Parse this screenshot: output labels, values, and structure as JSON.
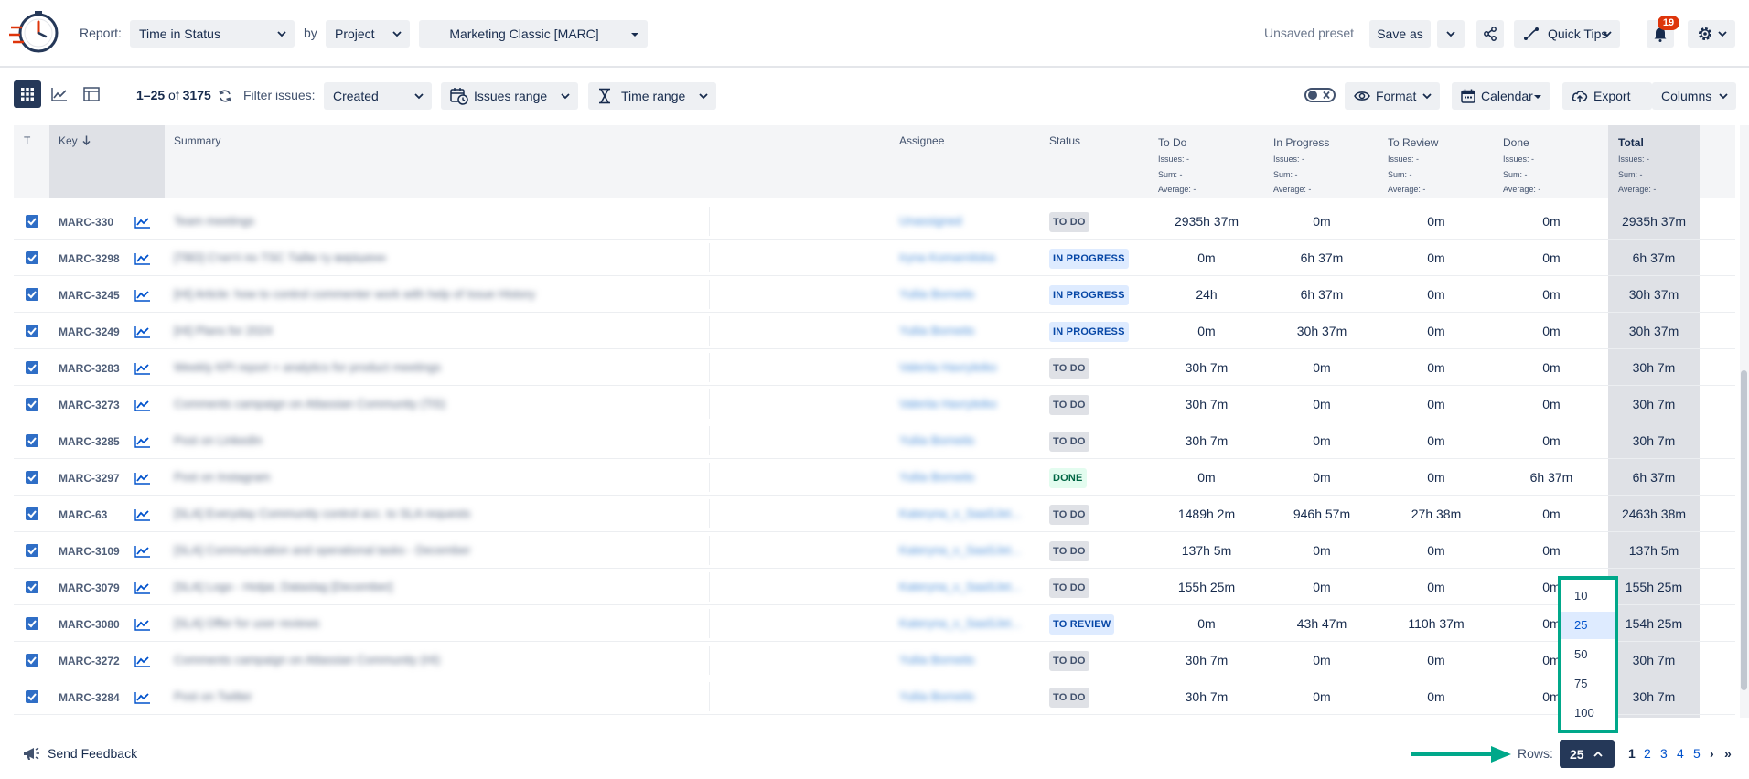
{
  "header": {
    "report_label": "Report:",
    "report_value": "Time in Status",
    "by_label": "by",
    "by_value": "Project",
    "project_value": "Marketing Classic [MARC]",
    "preset_status": "Unsaved preset",
    "save_as": "Save as",
    "quick_tips": "Quick Tips",
    "notifications_count": "19"
  },
  "toolbar": {
    "range_first": "1–25",
    "range_of": "of",
    "range_total": "3175",
    "filter_label": "Filter issues:",
    "filter_value": "Created",
    "issues_range": "Issues range",
    "time_range": "Time range",
    "format": "Format",
    "calendar": "Calendar",
    "export": "Export",
    "columns": "Columns"
  },
  "columns": {
    "t": "T",
    "key": "Key",
    "summary": "Summary",
    "assignee": "Assignee",
    "status": "Status",
    "todo": "To Do",
    "inprogress": "In Progress",
    "toreview": "To Review",
    "done": "Done",
    "total": "Total",
    "issues_sub": "Issues: -",
    "sum_sub": "Sum: -",
    "avg_sub": "Average: -"
  },
  "rows": [
    {
      "key": "MARC-330",
      "summary": "Team meetings",
      "assignee": "Unassigned",
      "status": "TO DO",
      "todo": "2935h 37m",
      "prog": "0m",
      "rev": "0m",
      "done": "0m",
      "total": "2935h 37m"
    },
    {
      "key": "MARC-3298",
      "summary": "[TBD] Статті по TSC Тайм ту вирішенн",
      "assignee": "Iryna Komarnitska",
      "status": "IN PROGRESS",
      "todo": "0m",
      "prog": "6h 37m",
      "rev": "0m",
      "done": "0m",
      "total": "6h 37m"
    },
    {
      "key": "MARC-3245",
      "summary": "[HI] Article: how to control commenter work with help of Issue History",
      "assignee": "Yuliia Borneits",
      "status": "IN PROGRESS",
      "todo": "24h",
      "prog": "6h 37m",
      "rev": "0m",
      "done": "0m",
      "total": "30h 37m"
    },
    {
      "key": "MARC-3249",
      "summary": "[HI] Plans for 2024",
      "assignee": "Yuliia Borneits",
      "status": "IN PROGRESS",
      "todo": "0m",
      "prog": "30h 37m",
      "rev": "0m",
      "done": "0m",
      "total": "30h 37m"
    },
    {
      "key": "MARC-3283",
      "summary": "Weekly KPI report + analytics for product meetings",
      "assignee": "Valeriia Havryleiko",
      "status": "TO DO",
      "todo": "30h 7m",
      "prog": "0m",
      "rev": "0m",
      "done": "0m",
      "total": "30h 7m"
    },
    {
      "key": "MARC-3273",
      "summary": "Comments campaign on Atlassian Community (TiS)",
      "assignee": "Valeriia Havryleiko",
      "status": "TO DO",
      "todo": "30h 7m",
      "prog": "0m",
      "rev": "0m",
      "done": "0m",
      "total": "30h 7m"
    },
    {
      "key": "MARC-3285",
      "summary": "Post on LinkedIn",
      "assignee": "Yuliia Borneits",
      "status": "TO DO",
      "todo": "30h 7m",
      "prog": "0m",
      "rev": "0m",
      "done": "0m",
      "total": "30h 7m"
    },
    {
      "key": "MARC-3297",
      "summary": "Post on Instagram",
      "assignee": "Yuliia Borneits",
      "status": "DONE",
      "todo": "0m",
      "prog": "0m",
      "rev": "0m",
      "done": "6h 37m",
      "total": "6h 37m"
    },
    {
      "key": "MARC-63",
      "summary": "[SLA] Everyday Community control acc. to SLA requests",
      "assignee": "Kateryna_v_SaaSJet...",
      "status": "TO DO",
      "todo": "1489h 2m",
      "prog": "946h 57m",
      "rev": "27h 38m",
      "done": "0m",
      "total": "2463h 38m"
    },
    {
      "key": "MARC-3109",
      "summary": "[SLA] Communication and operational tasks - December",
      "assignee": "Kateryna_v_SaaSJet...",
      "status": "TO DO",
      "todo": "137h 5m",
      "prog": "0m",
      "rev": "0m",
      "done": "0m",
      "total": "137h 5m"
    },
    {
      "key": "MARC-3079",
      "summary": "[SLA] Logo - Hotjar, Dataslag [December]",
      "assignee": "Kateryna_v_SaaSJet...",
      "status": "TO DO",
      "todo": "155h 25m",
      "prog": "0m",
      "rev": "0m",
      "done": "0m",
      "total": "155h 25m"
    },
    {
      "key": "MARC-3080",
      "summary": "[SLA] Offer for user reviews",
      "assignee": "Kateryna_v_SaaSJet...",
      "status": "TO REVIEW",
      "todo": "0m",
      "prog": "43h 47m",
      "rev": "110h 37m",
      "done": "0m",
      "total": "154h 25m"
    },
    {
      "key": "MARC-3272",
      "summary": "Comments campaign on Atlassian Community (HI)",
      "assignee": "Yuliia Borneits",
      "status": "TO DO",
      "todo": "30h 7m",
      "prog": "0m",
      "rev": "0m",
      "done": "0m",
      "total": "30h 7m"
    },
    {
      "key": "MARC-3284",
      "summary": "Post on Twitter",
      "assignee": "Yuliia Borneits",
      "status": "TO DO",
      "todo": "30h 7m",
      "prog": "0m",
      "rev": "0m",
      "done": "0m",
      "total": "30h 7m"
    }
  ],
  "rows_dropdown": {
    "options": [
      "10",
      "25",
      "50",
      "75",
      "100"
    ],
    "selected": "25"
  },
  "footer": {
    "send_feedback": "Send Feedback",
    "rows_label": "Rows:",
    "rows_value": "25",
    "pages": [
      "1",
      "2",
      "3",
      "4",
      "5"
    ],
    "next": "›",
    "last": "»"
  },
  "colors": {
    "accent": "#00a88a",
    "primary": "#0052cc",
    "dark": "#253858",
    "badge": "#de350b"
  }
}
